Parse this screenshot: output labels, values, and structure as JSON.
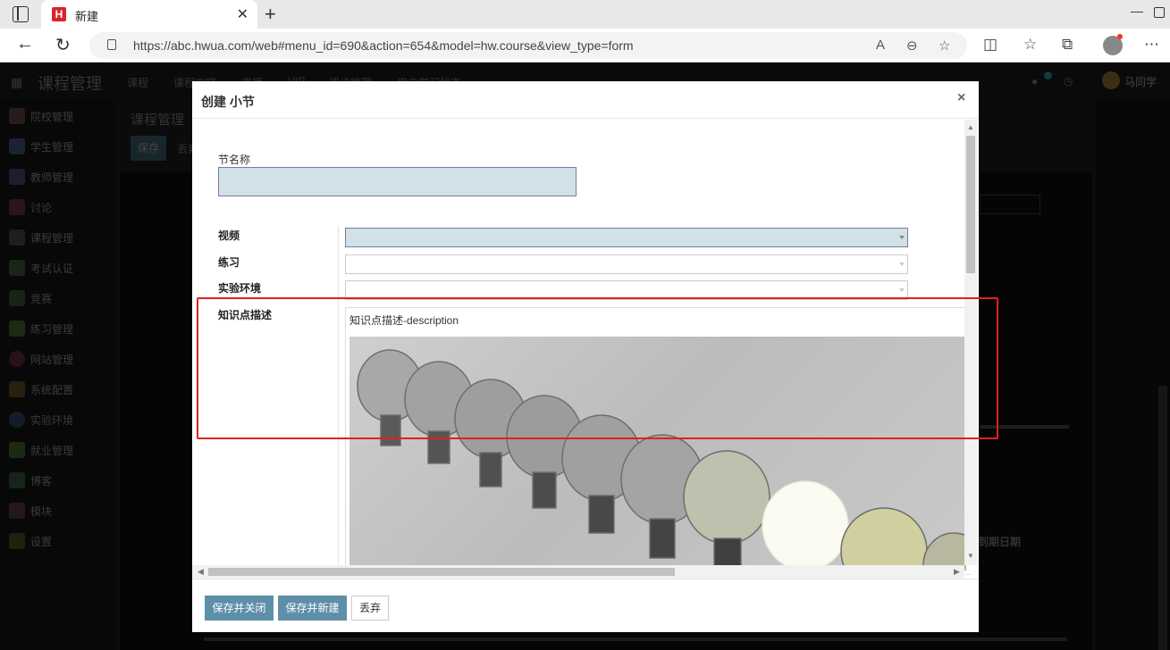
{
  "browser": {
    "tab_title": "新建",
    "tab_favicon_letter": "H",
    "url": "https://abc.hwua.com/web#menu_id=690&action=654&model=hw.course&view_type=form"
  },
  "app": {
    "title": "课程管理",
    "menu": [
      "课程",
      "课程内容",
      "直播",
      "VIP",
      "评论管理",
      "用户学习状态"
    ],
    "user_name": "马同学",
    "message_count": "1",
    "sidebar": [
      "院校管理",
      "学生管理",
      "教师管理",
      "讨论",
      "课程管理",
      "考试认证",
      "竞赛",
      "练习管理",
      "网站管理",
      "系统配置",
      "实验环境",
      "就业管理",
      "博客",
      "模块",
      "设置"
    ],
    "breadcrumb": "课程管理",
    "save_label": "保存",
    "discard_label": "丢弃",
    "bg_label": "到期日期"
  },
  "modal": {
    "title": "创建 小节",
    "close": "×",
    "fields": {
      "name_label": "节名称",
      "video_label": "视频",
      "exercise_label": "练习",
      "lab_label": "实验环境",
      "desc_label": "知识点描述",
      "desc_text": "知识点描述-description"
    },
    "footer": {
      "save_close": "保存并关闭",
      "save_new": "保存并新建",
      "discard": "丢弃"
    }
  },
  "colors": {
    "highlight": "#e02020",
    "primary_button": "#5e8fa8",
    "active_field": "#d2e0e8"
  }
}
